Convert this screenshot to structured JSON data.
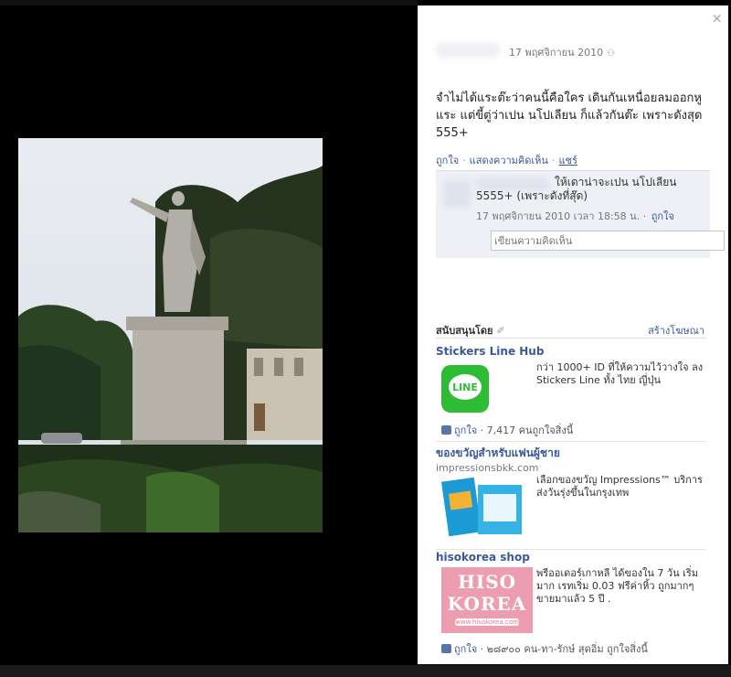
{
  "viewer": {
    "close_glyph": "×"
  },
  "post": {
    "date": "17 พฤศจิกายน 2010",
    "privacy_glyph": "⚇",
    "caption": "จำไม่ได้แระต๊ะว่าคนนี้คือใคร เดินกันเหนื่อยลมออกหูแระ แต่ขี้ตู่ว่าเปน นโปเลียน ก็แล้วกันต๊ะ เพราะดังสุด 555+",
    "actions": [
      "ถูกใจ",
      "แสดงความคิดเห็น",
      "แชร์"
    ]
  },
  "comment": {
    "text": "ให้เดาน่าจะเปน นโปเลียน 5555+ (เพราะดังที่สุ๊ด)",
    "time": "17 พฤศจิกายน 2010 เวลา 18:58 น.",
    "like": "ถูกใจ",
    "input_placeholder": "เขียนความคิดเห็น"
  },
  "sponsored": {
    "title": "สนับสนุนโดย",
    "title_glyph": "✐",
    "create_ad": "สร้างโฆษณา",
    "ads": [
      {
        "title": "Stickers Line Hub",
        "subtitle": "",
        "body": "กว่า 1000+ ID ที่ให้ความไว้วางใจ ลง Stickers Line ทั้ง ไทย ญี่ปุ่น",
        "like_label": "ถูกใจ",
        "like_count": "7,417 คนถูกใจสิ่งนี้",
        "logo_text": "LINE"
      },
      {
        "title": "ของขวัญสำหรับแฟนผู้ชาย",
        "subtitle": "impressionsbkk.com",
        "body": "เลือกของขวัญ Impressions™ บริการส่งวันรุ่งขึ้นในกรุงเทพ",
        "like_label": "",
        "like_count": ""
      },
      {
        "title": "hisokorea shop",
        "subtitle": "",
        "body": "พรีออเดอร์เกาหลี ได้ของใน 7 วัน เริ่มมาก เรทเริ่ม 0.03 ฟรีค่าหิ้ว ถูกมากๆ ขายมาแล้ว 5 ปี .",
        "like_label": "ถูกใจ",
        "like_count": "๒๘๙๐๐ คน-ทา-รักษ์ สุดอิ่ม ถูกใจสิ่งนี้",
        "logo_line1": "HISO",
        "logo_line2": "KOREA",
        "logo_url": "www.hisokorea.com"
      }
    ]
  }
}
